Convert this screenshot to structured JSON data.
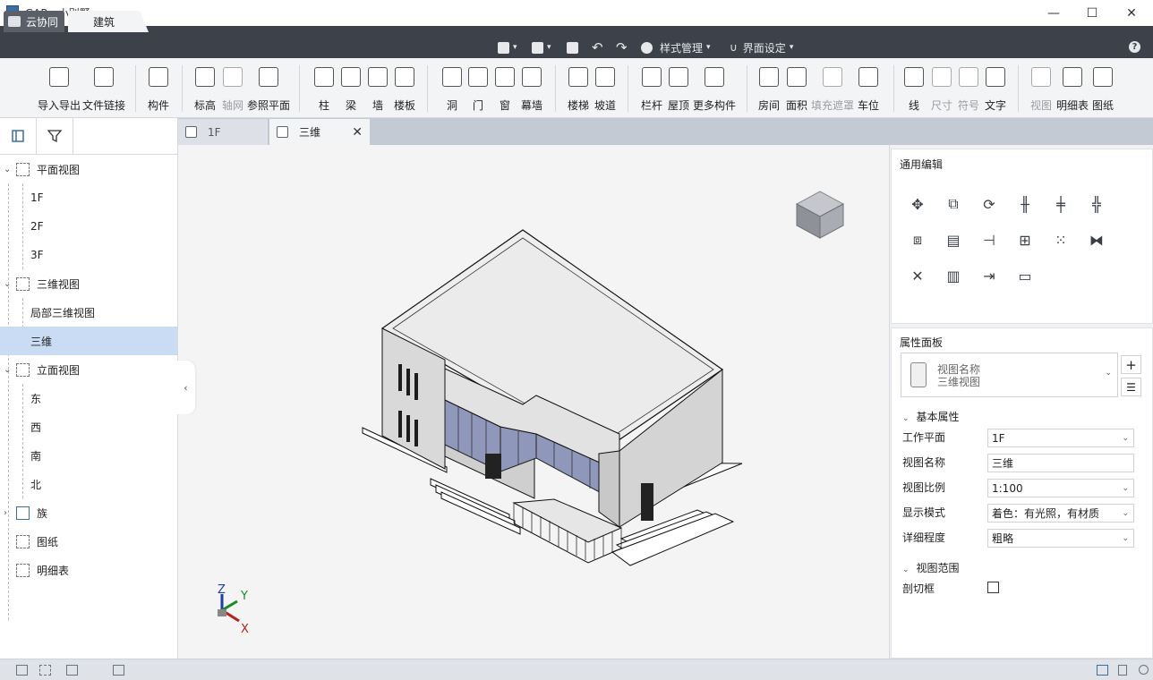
{
  "window": {
    "title": "GAP - 小别墅",
    "minimize": "—",
    "maximize": "☐",
    "close": "✕"
  },
  "menubar": {
    "tabs": [
      "云协同",
      "建筑"
    ],
    "quick": {
      "style_mgmt": "样式管理",
      "ui_settings": "界面设定"
    },
    "help": "?"
  },
  "ribbon": {
    "import_export": "导入导出",
    "file_link": "文件链接",
    "component": "构件",
    "elevation": "标高",
    "grid": "轴网",
    "ref_plane": "参照平面",
    "column": "柱",
    "beam": "梁",
    "wall": "墙",
    "floor": "楼板",
    "opening": "洞",
    "door": "门",
    "window": "窗",
    "curtain_wall": "幕墙",
    "stair": "楼梯",
    "ramp": "坡道",
    "railing": "栏杆",
    "roof": "屋顶",
    "more": "更多构件",
    "room": "房间",
    "area": "面积",
    "fill_mask": "填充遮罩",
    "parking": "车位",
    "line": "线",
    "dimension": "尺寸",
    "symbol": "符号",
    "text": "文字",
    "view": "视图",
    "schedule": "明细表",
    "sheet": "图纸"
  },
  "tree": {
    "plan_views": "平面视图",
    "f1": "1F",
    "f2": "2F",
    "f3": "3F",
    "views_3d": "三维视图",
    "partial_3d": "局部三维视图",
    "three_d": "三维",
    "elevations": "立面视图",
    "east": "东",
    "west": "西",
    "south": "南",
    "north": "北",
    "families": "族",
    "sheets": "图纸",
    "schedules": "明细表"
  },
  "doctabs": {
    "tab1": "1F",
    "tab2": "三维"
  },
  "axes": {
    "z": "Z",
    "y": "Y",
    "x": "X"
  },
  "right": {
    "general_edit": "通用编辑",
    "properties": "属性面板",
    "type_label": "视图名称",
    "type_value": "三维视图",
    "basic_props": "基本属性",
    "work_plane_label": "工作平面",
    "work_plane_value": "1F",
    "view_name_label": "视图名称",
    "view_name_value": "三维",
    "scale_label": "视图比例",
    "scale_value": "1:100",
    "display_label": "显示模式",
    "display_value": "着色：有光照，有材质",
    "detail_label": "详细程度",
    "detail_value": "粗略",
    "view_range": "视图范围",
    "section_box_label": "剖切框"
  },
  "colors": {
    "accent": "#c9dcf3",
    "menubar": "#3d4149",
    "ribbon": "#f3f4f6"
  }
}
